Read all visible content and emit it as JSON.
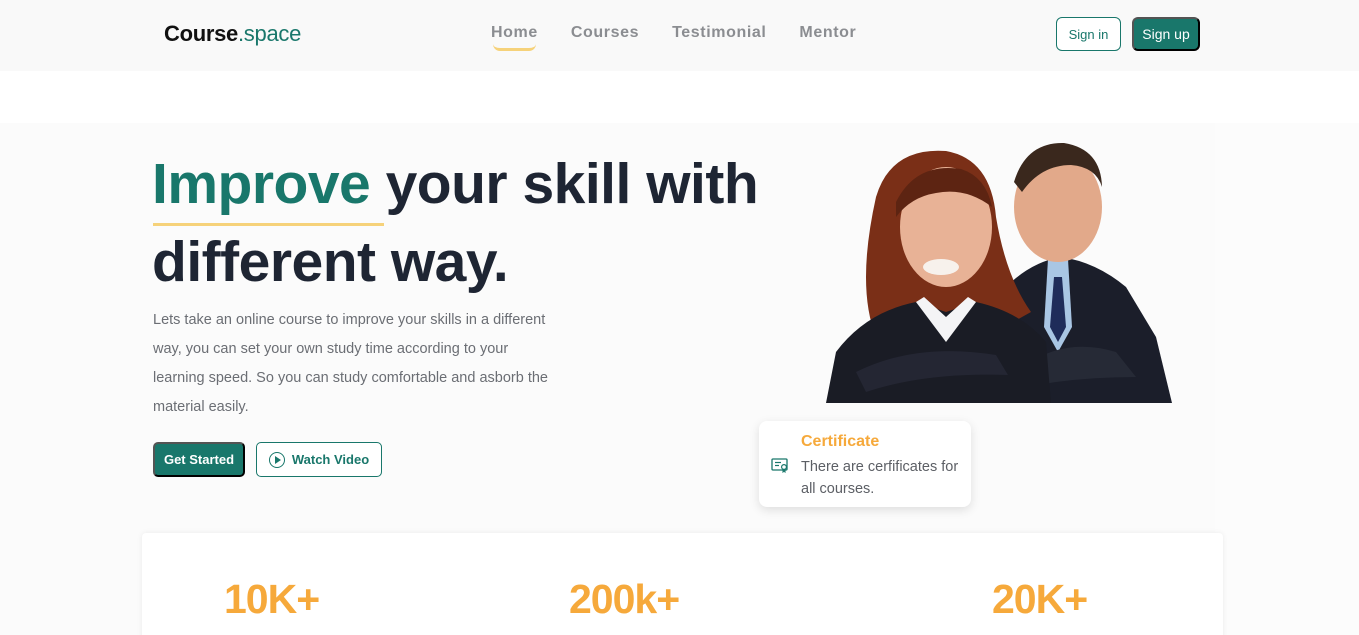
{
  "brand": {
    "part1": "Course",
    "part2": ".space"
  },
  "nav": {
    "items": [
      {
        "label": "Home",
        "active": true
      },
      {
        "label": "Courses",
        "active": false
      },
      {
        "label": "Testimonial",
        "active": false
      },
      {
        "label": "Mentor",
        "active": false
      }
    ],
    "signin_label": "Sign in",
    "signup_label": "Sign up"
  },
  "hero": {
    "title_accent": "Improve",
    "title_rest": "your skill with",
    "title_line2": "different way.",
    "description": "Lets take an online course to improve your skills in a different way, you can set your own study time according to your learning speed. So you can study comfortable and asborb the material easily.",
    "primary_button": "Get Started",
    "secondary_button": "Watch Video"
  },
  "certificate": {
    "title": "Certificate",
    "text": "There are cerfificates for all courses."
  },
  "stats": [
    {
      "value": "10K+"
    },
    {
      "value": "200k+"
    },
    {
      "value": "20K+"
    }
  ],
  "colors": {
    "primary": "#19776b",
    "accent_yellow": "#f6d27a",
    "accent_orange": "#f6a93b",
    "heading": "#1e2533",
    "muted": "#6b6e74"
  },
  "icons": {
    "play": "play-circle-icon",
    "certificate": "certificate-icon"
  }
}
